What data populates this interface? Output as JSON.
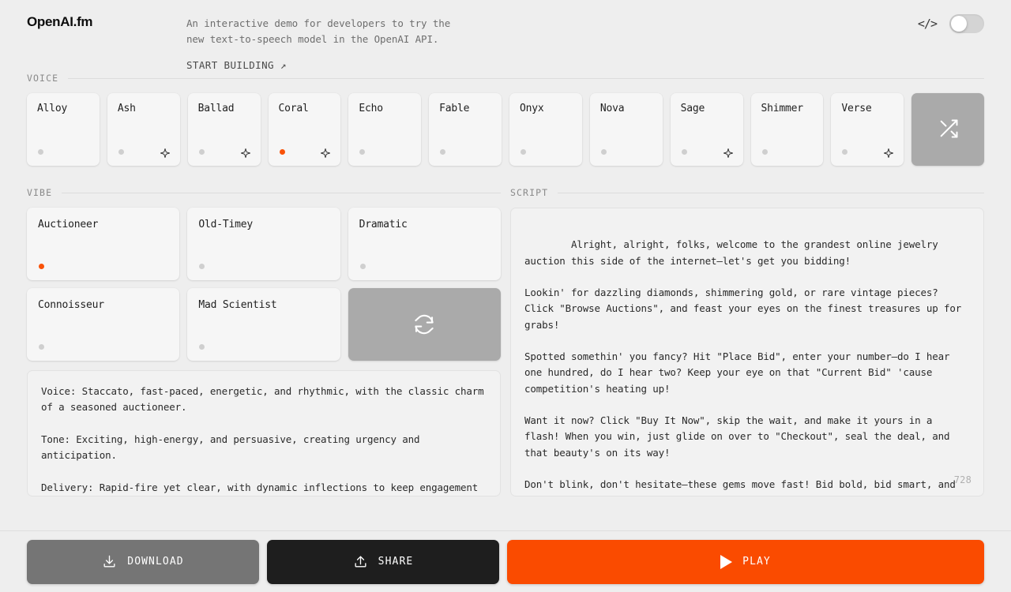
{
  "header": {
    "brand": "OpenAI.fm",
    "tagline": "An interactive demo for developers to try the new text-to-speech model in the OpenAI API.",
    "start_building": "START BUILDING ↗",
    "code_icon_label": "</>",
    "toggle_state": "off"
  },
  "sections": {
    "voice_label": "VOICE",
    "vibe_label": "VIBE",
    "script_label": "SCRIPT"
  },
  "voices": [
    {
      "name": "Alloy",
      "selected": false,
      "sparkle": false
    },
    {
      "name": "Ash",
      "selected": false,
      "sparkle": true
    },
    {
      "name": "Ballad",
      "selected": false,
      "sparkle": true
    },
    {
      "name": "Coral",
      "selected": true,
      "sparkle": true
    },
    {
      "name": "Echo",
      "selected": false,
      "sparkle": false
    },
    {
      "name": "Fable",
      "selected": false,
      "sparkle": false
    },
    {
      "name": "Onyx",
      "selected": false,
      "sparkle": false
    },
    {
      "name": "Nova",
      "selected": false,
      "sparkle": false
    },
    {
      "name": "Sage",
      "selected": false,
      "sparkle": true
    },
    {
      "name": "Shimmer",
      "selected": false,
      "sparkle": false
    },
    {
      "name": "Verse",
      "selected": false,
      "sparkle": true
    }
  ],
  "voice_random": {
    "icon": "shuffle-icon"
  },
  "vibes": [
    {
      "name": "Auctioneer",
      "selected": true
    },
    {
      "name": "Old-Timey",
      "selected": false
    },
    {
      "name": "Dramatic",
      "selected": false
    },
    {
      "name": "Connoisseur",
      "selected": false
    },
    {
      "name": "Mad Scientist",
      "selected": false
    }
  ],
  "vibe_refresh": {
    "icon": "refresh-icon"
  },
  "vibe_description": "Voice: Staccato, fast-paced, energetic, and rhythmic, with the classic charm of a seasoned auctioneer.\n\nTone: Exciting, high-energy, and persuasive, creating urgency and anticipation.\n\nDelivery: Rapid-fire yet clear, with dynamic inflections to keep engagement high and momentum strong.",
  "script": {
    "text": "Alright, alright, folks, welcome to the grandest online jewelry auction this side of the internet—let's get you bidding!\n\nLookin' for dazzling diamonds, shimmering gold, or rare vintage pieces? Click \"Browse Auctions\", and feast your eyes on the finest treasures up for grabs!\n\nSpotted somethin' you fancy? Hit \"Place Bid\", enter your number—do I hear one hundred, do I hear two? Keep your eye on that \"Current Bid\" 'cause competition's heating up!\n\nWant it now? Click \"Buy It Now\", skip the wait, and make it yours in a flash! When you win, just glide on over to \"Checkout\", seal the deal, and that beauty's on its way!\n\nDon't blink, don't hesitate—these gems move fast! Bid bold, bid smart, and may fortune shine on you! SOLD!",
    "char_count": "728"
  },
  "footer": {
    "download_label": "DOWNLOAD",
    "share_label": "SHARE",
    "play_label": "PLAY"
  },
  "colors": {
    "accent_orange": "#f95208",
    "play_button": "#fa4b00",
    "share_button": "#1e1e1e",
    "download_button": "#757575",
    "page_background": "#eeeeee"
  }
}
